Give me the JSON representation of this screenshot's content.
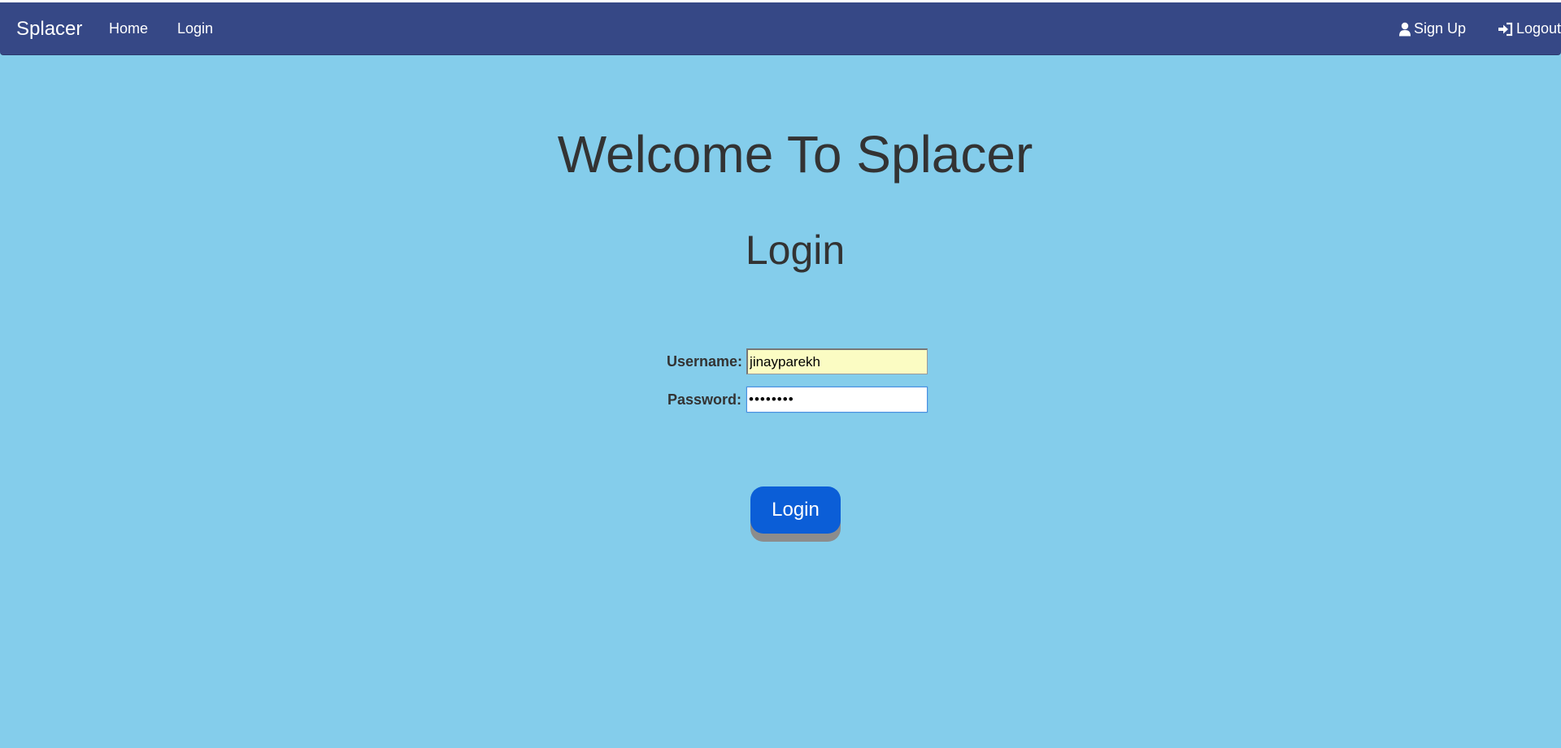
{
  "navbar": {
    "brand": "Splacer",
    "links": {
      "home": "Home",
      "login": "Login"
    },
    "right": {
      "signup": "Sign Up",
      "signup_icon": "user-icon",
      "logout": "Logout",
      "logout_icon": "log-in-icon"
    }
  },
  "main": {
    "welcome": "Welcome To Splacer",
    "login_heading": "Login",
    "form": {
      "username_label": "Username:",
      "username_value": "jinayparekh",
      "password_label": "Password:",
      "password_value": "••••••••",
      "submit_label": "Login"
    }
  },
  "colors": {
    "page_background": "#84cdeb",
    "navbar": "#364886",
    "button": "#0b5ed7",
    "autofill": "#fbfcc3"
  }
}
